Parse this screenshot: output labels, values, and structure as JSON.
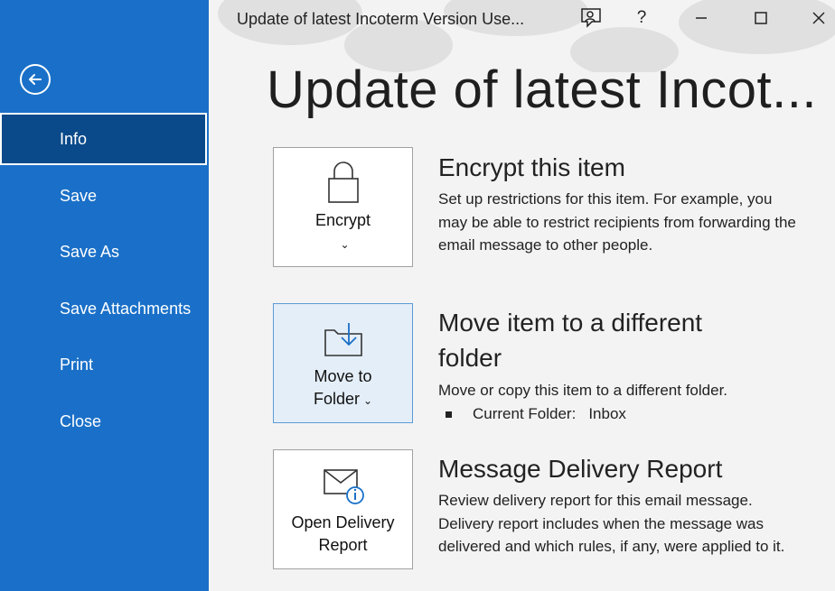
{
  "window": {
    "title": "Update of  latest Incoterm Version Use...",
    "help_label": "?"
  },
  "sidebar": {
    "items": [
      {
        "label": "Info",
        "active": true
      },
      {
        "label": "Save"
      },
      {
        "label": "Save As"
      },
      {
        "label": "Save Attachments"
      },
      {
        "label": "Print"
      },
      {
        "label": "Close"
      }
    ]
  },
  "main": {
    "page_title": "Update of  latest Incot...",
    "sections": [
      {
        "button_label": "Encrypt",
        "title": "Encrypt this item",
        "description": "Set up restrictions for this item. For example, you may be able to restrict recipients from forwarding the email message to other people.",
        "icon": "lock-icon"
      },
      {
        "button_label_line1": "Move to",
        "button_label_line2": "Folder",
        "title_line1": "Move item to a different",
        "title_line2": "folder",
        "description": "Move or copy this item to a different folder.",
        "bullet_label": "Current Folder:",
        "bullet_value": "Inbox",
        "icon": "move-folder-icon"
      },
      {
        "button_label_line1": "Open Delivery",
        "button_label_line2": "Report",
        "title": "Message Delivery Report",
        "description": "Review delivery report for this email message. Delivery report includes when the message was delivered and which rules, if any, were applied to it.",
        "icon": "envelope-info-icon"
      }
    ]
  },
  "colors": {
    "sidebar_bg": "#1a70c8",
    "sidebar_active": "#0a4a8a",
    "accent": "#1a70c8",
    "card_highlight": "#e4eef8"
  }
}
